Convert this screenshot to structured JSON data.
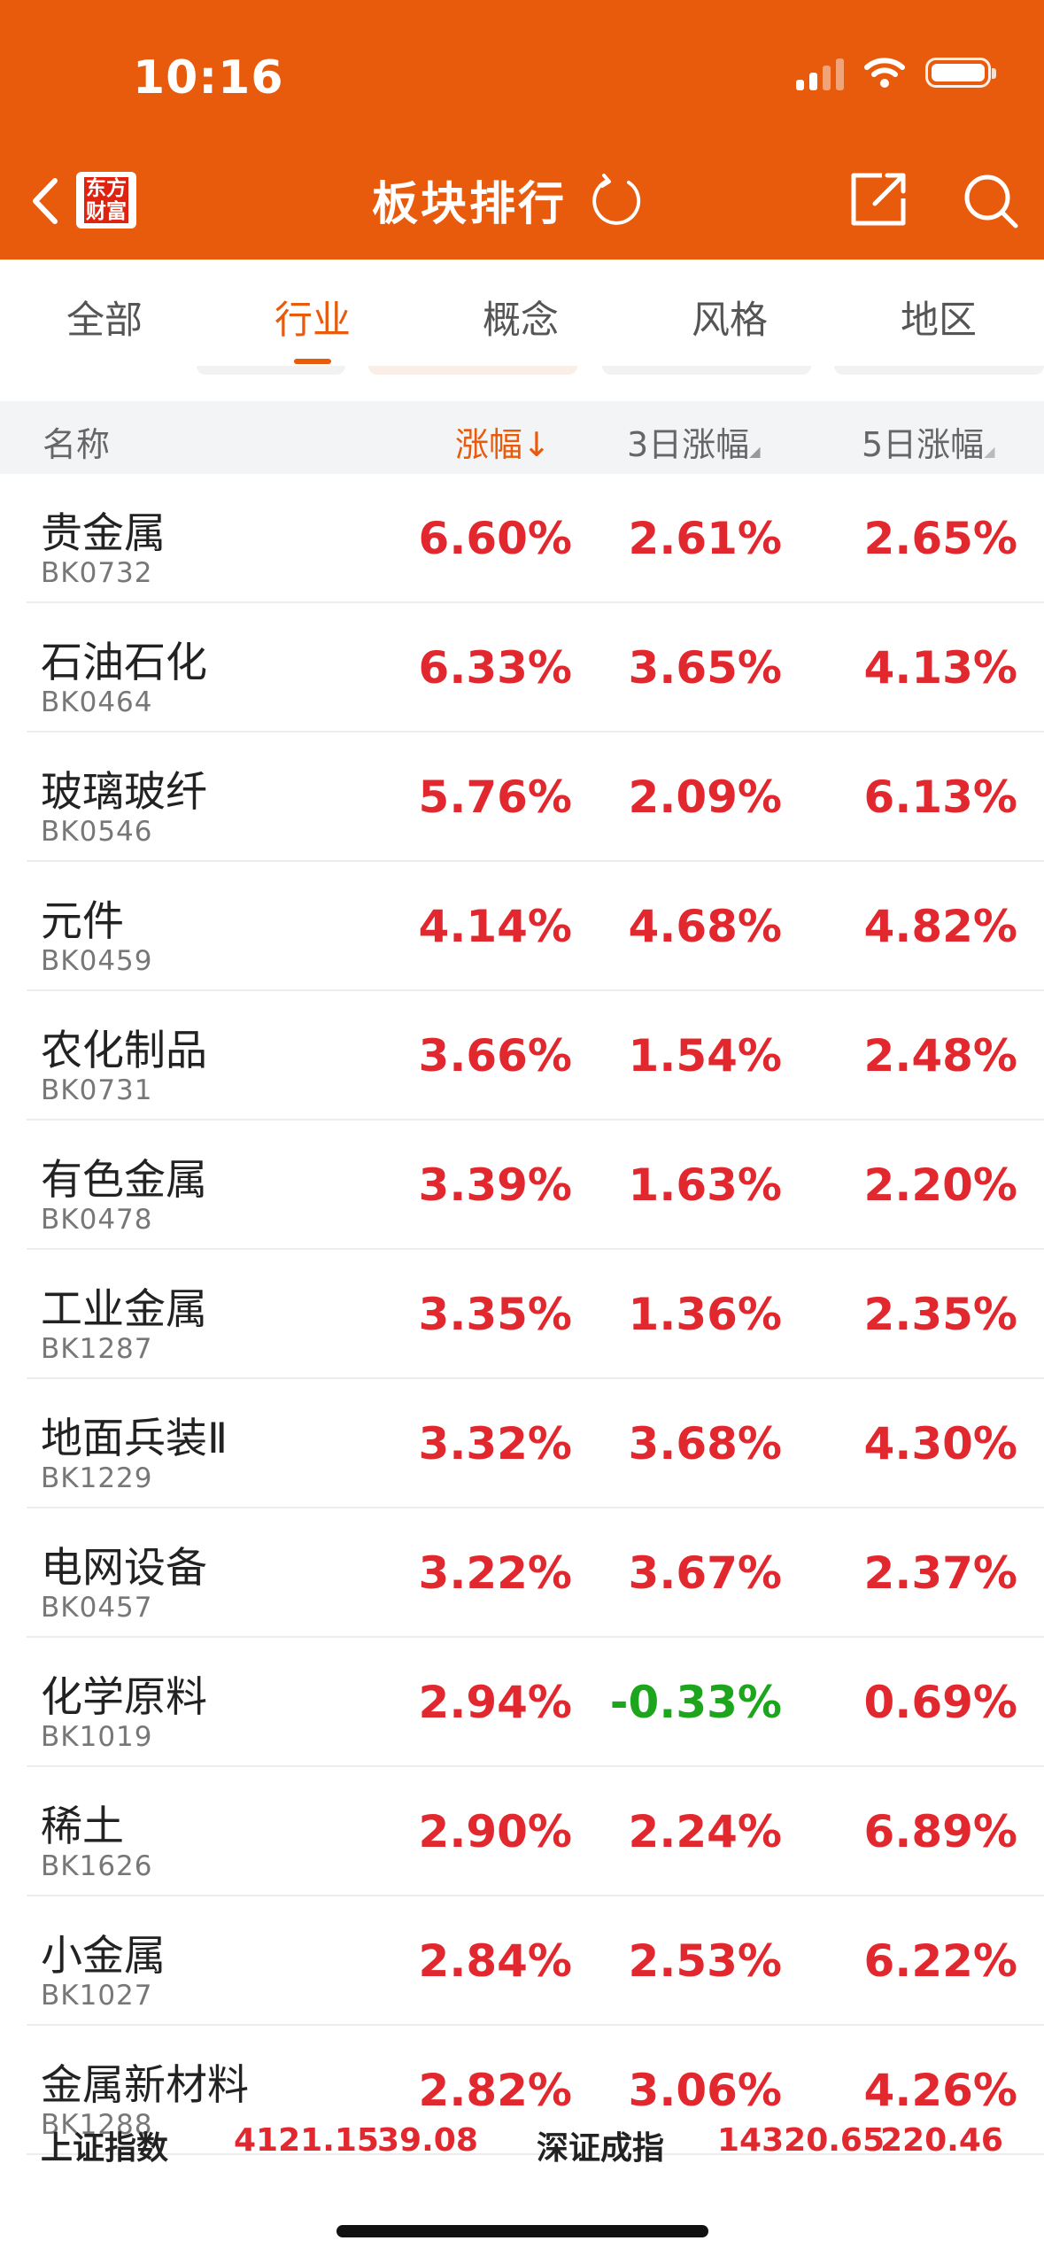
{
  "status_bar": {
    "time": "10:16"
  },
  "header": {
    "logo_line1": "东方",
    "logo_line2": "财富",
    "title": "板块排行"
  },
  "tabs": [
    {
      "label": "全部"
    },
    {
      "label": "行业"
    },
    {
      "label": "概念"
    },
    {
      "label": "风格"
    },
    {
      "label": "地区"
    }
  ],
  "columns": {
    "name": "名称",
    "change": "涨幅",
    "change_sort_arrow": "↓",
    "change_3d": "3日涨幅",
    "change_5d": "5日涨幅"
  },
  "rows": [
    {
      "name": "贵金属",
      "code": "BK0732",
      "change": "6.60%",
      "change_3d": "2.61%",
      "change_5d": "2.65%"
    },
    {
      "name": "石油石化",
      "code": "BK0464",
      "change": "6.33%",
      "change_3d": "3.65%",
      "change_5d": "4.13%"
    },
    {
      "name": "玻璃玻纤",
      "code": "BK0546",
      "change": "5.76%",
      "change_3d": "2.09%",
      "change_5d": "6.13%"
    },
    {
      "name": "元件",
      "code": "BK0459",
      "change": "4.14%",
      "change_3d": "4.68%",
      "change_5d": "4.82%"
    },
    {
      "name": "农化制品",
      "code": "BK0731",
      "change": "3.66%",
      "change_3d": "1.54%",
      "change_5d": "2.48%"
    },
    {
      "name": "有色金属",
      "code": "BK0478",
      "change": "3.39%",
      "change_3d": "1.63%",
      "change_5d": "2.20%"
    },
    {
      "name": "工业金属",
      "code": "BK1287",
      "change": "3.35%",
      "change_3d": "1.36%",
      "change_5d": "2.35%"
    },
    {
      "name": "地面兵装Ⅱ",
      "code": "BK1229",
      "change": "3.32%",
      "change_3d": "3.68%",
      "change_5d": "4.30%"
    },
    {
      "name": "电网设备",
      "code": "BK0457",
      "change": "3.22%",
      "change_3d": "3.67%",
      "change_5d": "2.37%"
    },
    {
      "name": "化学原料",
      "code": "BK1019",
      "change": "2.94%",
      "change_3d": "-0.33%",
      "change_5d": "0.69%"
    },
    {
      "name": "稀土",
      "code": "BK1626",
      "change": "2.90%",
      "change_3d": "2.24%",
      "change_5d": "6.89%"
    },
    {
      "name": "小金属",
      "code": "BK1027",
      "change": "2.84%",
      "change_3d": "2.53%",
      "change_5d": "6.22%"
    },
    {
      "name": "金属新材料",
      "code": "BK1288",
      "change": "2.82%",
      "change_3d": "3.06%",
      "change_5d": "4.26%"
    }
  ],
  "index_bar": {
    "sh_label": "上证指数",
    "sh_value": "4121.15",
    "sh_change": "39.08",
    "sz_label": "深证成指",
    "sz_value": "14320.65",
    "sz_change": "220.46"
  },
  "colors": {
    "brand": "#e85a0c",
    "up": "#e0282e",
    "down": "#1ea51e"
  }
}
